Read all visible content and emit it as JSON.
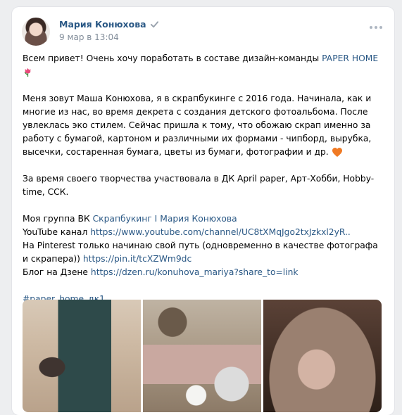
{
  "post": {
    "author": "Мария Конюхова",
    "date": "9 мар в 13:04",
    "paragraph1": {
      "text": "Всем привет! Очень хочу поработать в составе дизайн-команды ",
      "link": "PAPER HOME"
    },
    "paragraph2": "Меня зовут Маша Конюхова, я в скрапбукинге с 2016 года. Начинала, как и многие из нас, во время декрета с создания детского фотоальбома. После увлеклась эко стилем. Сейчас пришла к тому, что обожаю скрап именно за работу с бумагой, картоном и различными их формами - чипборд, вырубка, высечки, состаренная бумага, цветы из бумаги, фотографии и др.",
    "paragraph3": "За время своего творчества участвовала в ДК April paper, Арт-Хобби, Hobby-time, ССК.",
    "links": {
      "group_label": "Моя группа ВК ",
      "group_link": "Скрапбукинг I Мария Конюхова",
      "youtube_label": "YouTube канал ",
      "youtube_link": "https://www.youtube.com/channel/UC8tXMqJgo2txJzkxl2yR..",
      "pinterest_label": "На Pinterest только начинаю свой путь (одновременно в качестве фотографа и скрапера)) ",
      "pinterest_link": "https://pin.it/tcXZWm9dc",
      "dzen_label": "Блог на Дзене ",
      "dzen_link": "https://dzen.ru/konuhova_mariya?share_to=link"
    },
    "hashtag": "#paper_home_дк1"
  },
  "icons": [
    "verified-check-icon",
    "more-options-icon",
    "tulip-emoji-icon",
    "heart-emoji-icon"
  ],
  "colors": {
    "link": "#2a5885",
    "muted": "#818c99",
    "background": "#edeef0",
    "card": "#ffffff"
  }
}
